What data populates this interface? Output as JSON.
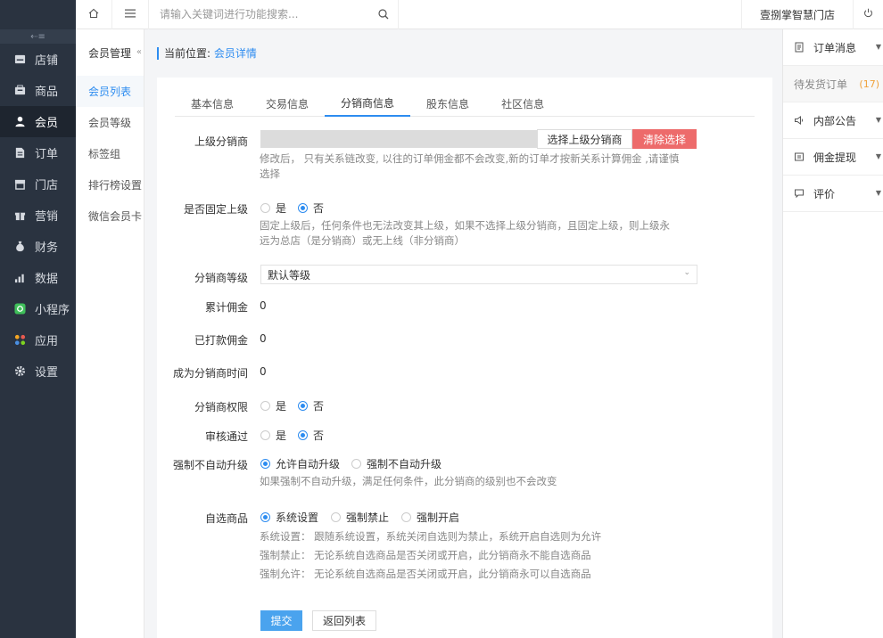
{
  "nav": {
    "items": [
      {
        "label": "店铺",
        "icon": "store-icon"
      },
      {
        "label": "商品",
        "icon": "goods-icon"
      },
      {
        "label": "会员",
        "icon": "user-icon",
        "active": true
      },
      {
        "label": "订单",
        "icon": "order-icon"
      },
      {
        "label": "门店",
        "icon": "shop-icon"
      },
      {
        "label": "营销",
        "icon": "gift-icon"
      },
      {
        "label": "财务",
        "icon": "money-bag-icon"
      },
      {
        "label": "数据",
        "icon": "chart-icon"
      },
      {
        "label": "小程序",
        "icon": "miniapp-icon"
      },
      {
        "label": "应用",
        "icon": "apps-icon"
      },
      {
        "label": "设置",
        "icon": "gear-icon"
      }
    ]
  },
  "subnav": {
    "title": "会员管理",
    "items": [
      "会员列表",
      "会员等级",
      "标签组",
      "排行榜设置",
      "微信会员卡"
    ]
  },
  "topbar": {
    "search_placeholder": "请输入关键词进行功能搜索...",
    "store_name": "壹捌掌智慧门店"
  },
  "breadcrumb": {
    "prefix": "当前位置:",
    "current": "会员详情"
  },
  "tabs": [
    "基本信息",
    "交易信息",
    "分销商信息",
    "股东信息",
    "社区信息"
  ],
  "form": {
    "parent": {
      "label": "上级分销商",
      "select_btn": "选择上级分销商",
      "clear_btn": "清除选择",
      "help_line1": "修改后， 只有关系链改变, 以往的订单佣金都不会改变,新的订单才按新关系计算佣金 ,请谨慎",
      "help_line2": "选择"
    },
    "fixed_parent": {
      "label": "是否固定上级",
      "yes": "是",
      "no": "否",
      "help_line1": "固定上级后，任何条件也无法改变其上级，如果不选择上级分销商，且固定上级，则上级永",
      "help_line2": "远为总店（是分销商）或无上线（非分销商）"
    },
    "level": {
      "label": "分销商等级",
      "value": "默认等级"
    },
    "total_commission": {
      "label": "累计佣金",
      "value": "0"
    },
    "paid_commission": {
      "label": "已打款佣金",
      "value": "0"
    },
    "become_time": {
      "label": "成为分销商时间",
      "value": "0"
    },
    "permission": {
      "label": "分销商权限",
      "yes": "是",
      "no": "否"
    },
    "audit": {
      "label": "审核通过",
      "yes": "是",
      "no": "否"
    },
    "force_upgrade": {
      "label": "强制不自动升级",
      "opt1": "允许自动升级",
      "opt2": "强制不自动升级",
      "help": "如果强制不自动升级，满足任何条件，此分销商的级别也不会改变"
    },
    "self_goods": {
      "label": "自选商品",
      "opt1": "系统设置",
      "opt2": "强制禁止",
      "opt3": "强制开启",
      "help1": "系统设置： 跟随系统设置，系统关闭自选则为禁止，系统开启自选则为允许",
      "help2": "强制禁止： 无论系统自选商品是否关闭或开启，此分销商永不能自选商品",
      "help3": "强制允许： 无论系统自选商品是否关闭或开启，此分销商永可以自选商品"
    },
    "submit": "提交",
    "back": "返回列表"
  },
  "right_panel": {
    "items": [
      {
        "label": "订单消息",
        "icon": "document-icon"
      },
      {
        "label": "内部公告",
        "icon": "speaker-icon"
      },
      {
        "label": "佣金提现",
        "icon": "wallet-icon"
      },
      {
        "label": "评价",
        "icon": "comment-icon"
      }
    ],
    "pending_label": "待发货订单",
    "pending_count": "(17)"
  },
  "colors": {
    "sidebar": "#2a3340",
    "accent": "#2d8cf0",
    "danger": "#ed6b6b",
    "submit": "#4aa3ee"
  }
}
